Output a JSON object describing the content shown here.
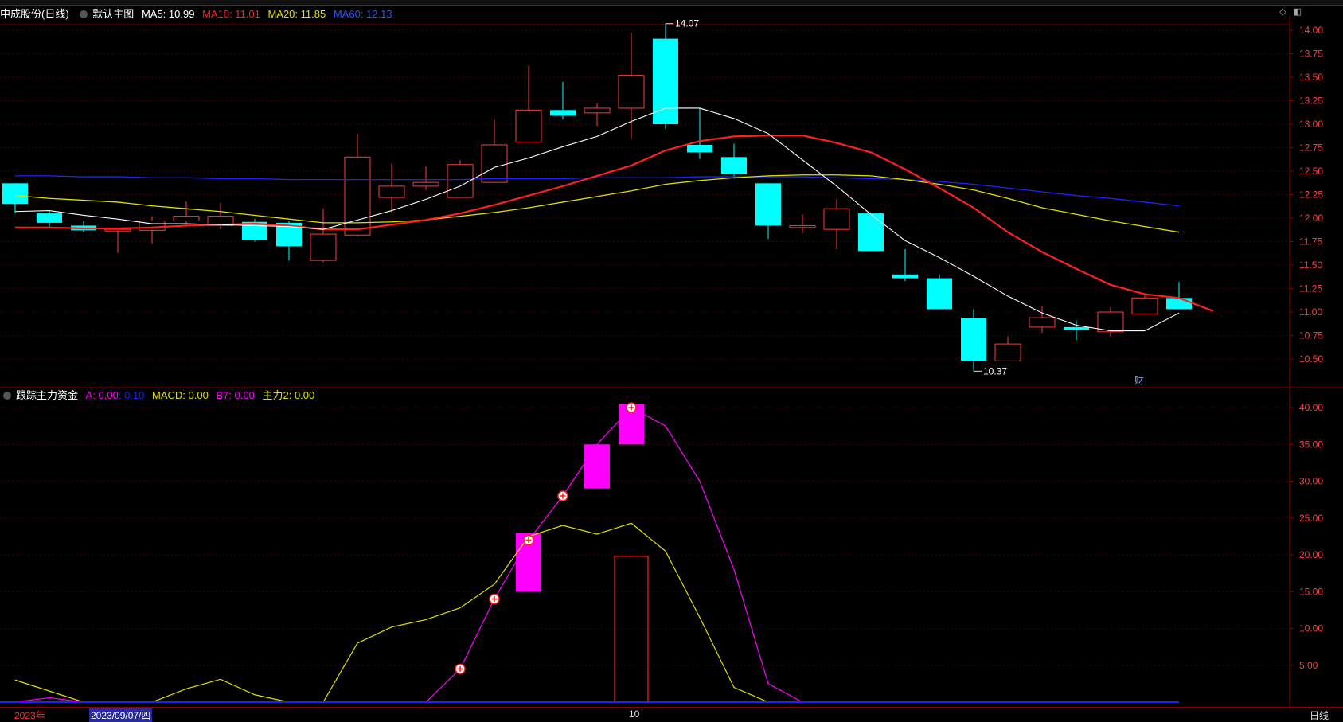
{
  "header": {
    "stock_title": "中成股份(日线)",
    "template_label": "默认主图",
    "ma5": "MA5: 10.99",
    "ma10": "MA10: 11.01",
    "ma20": "MA20: 11.85",
    "ma60": "MA60: 12.13"
  },
  "sub_header": {
    "indicator_name": "跟踪主力资金",
    "a_label": "A: 0.00",
    "a_extra": ": 0.10",
    "macd_label": "MACD: 0.00",
    "b7_label": "B7: 0.00",
    "zhuli2_label": "主力2: 0.00"
  },
  "annotations": {
    "high": "14.07",
    "low": "10.37",
    "cai": "财"
  },
  "bottom": {
    "year_label": "2023年",
    "cursor_date": "2023/09/07/四",
    "month_marker": "10",
    "period_tab": "日线"
  },
  "colors": {
    "up": "#ff3b3b",
    "down": "#00ffff",
    "ma5": "#ffffff",
    "ma10": "#ff2020",
    "ma20": "#e0e000",
    "ma60": "#2020ff",
    "magenta": "#ff00ff",
    "grid": "#8b0000"
  },
  "chart_data": [
    {
      "type": "candlestick",
      "name": "main",
      "ylim": [
        10.37,
        14.07
      ],
      "y_ticks": [
        10.5,
        10.75,
        11.0,
        11.25,
        11.5,
        11.75,
        12.0,
        12.25,
        12.5,
        12.75,
        13.0,
        13.25,
        13.5,
        13.75,
        14.0
      ],
      "candles": [
        {
          "o": 12.37,
          "c": 12.15,
          "h": 12.37,
          "l": 12.05
        },
        {
          "o": 12.05,
          "c": 11.95,
          "h": 12.08,
          "l": 11.9
        },
        {
          "o": 11.92,
          "c": 11.87,
          "h": 11.97,
          "l": 11.85
        },
        {
          "o": 11.87,
          "c": 11.88,
          "h": 11.9,
          "l": 11.63
        },
        {
          "o": 11.87,
          "c": 11.97,
          "h": 12.02,
          "l": 11.73
        },
        {
          "o": 11.97,
          "c": 12.02,
          "h": 12.18,
          "l": 11.92
        },
        {
          "o": 11.92,
          "c": 12.02,
          "h": 12.16,
          "l": 11.88
        },
        {
          "o": 11.96,
          "c": 11.77,
          "h": 11.99,
          "l": 11.75
        },
        {
          "o": 11.95,
          "c": 11.7,
          "h": 11.97,
          "l": 11.55
        },
        {
          "o": 11.55,
          "c": 11.83,
          "h": 12.1,
          "l": 11.53
        },
        {
          "o": 11.82,
          "c": 12.65,
          "h": 12.9,
          "l": 11.8
        },
        {
          "o": 12.22,
          "c": 12.34,
          "h": 12.58,
          "l": 12.05
        },
        {
          "o": 12.34,
          "c": 12.38,
          "h": 12.55,
          "l": 12.3
        },
        {
          "o": 12.22,
          "c": 12.57,
          "h": 12.62,
          "l": 12.22
        },
        {
          "o": 12.38,
          "c": 12.78,
          "h": 13.05,
          "l": 12.38
        },
        {
          "o": 12.81,
          "c": 13.15,
          "h": 13.62,
          "l": 12.81
        },
        {
          "o": 13.15,
          "c": 13.09,
          "h": 13.45,
          "l": 13.05
        },
        {
          "o": 13.12,
          "c": 13.17,
          "h": 13.22,
          "l": 12.98
        },
        {
          "o": 13.17,
          "c": 13.52,
          "h": 13.97,
          "l": 12.85
        },
        {
          "o": 13.91,
          "c": 13.0,
          "h": 14.07,
          "l": 12.95
        },
        {
          "o": 12.78,
          "c": 12.7,
          "h": 13.17,
          "l": 12.63
        },
        {
          "o": 12.65,
          "c": 12.47,
          "h": 12.79,
          "l": 12.42
        },
        {
          "o": 12.37,
          "c": 11.92,
          "h": 12.37,
          "l": 11.78
        },
        {
          "o": 11.9,
          "c": 11.92,
          "h": 12.04,
          "l": 11.84
        },
        {
          "o": 11.88,
          "c": 12.1,
          "h": 12.2,
          "l": 11.67
        },
        {
          "o": 12.05,
          "c": 11.65,
          "h": 12.05,
          "l": 11.65
        },
        {
          "o": 11.4,
          "c": 11.36,
          "h": 11.67,
          "l": 11.33
        },
        {
          "o": 11.36,
          "c": 11.03,
          "h": 11.4,
          "l": 11.03
        },
        {
          "o": 10.94,
          "c": 10.48,
          "h": 11.03,
          "l": 10.37
        },
        {
          "o": 10.48,
          "c": 10.66,
          "h": 10.74,
          "l": 10.48
        },
        {
          "o": 10.84,
          "c": 10.94,
          "h": 11.06,
          "l": 10.78
        },
        {
          "o": 10.84,
          "c": 10.81,
          "h": 10.91,
          "l": 10.7
        },
        {
          "o": 10.79,
          "c": 11.0,
          "h": 11.05,
          "l": 10.74
        },
        {
          "o": 10.98,
          "c": 11.15,
          "h": 11.18,
          "l": 10.98
        },
        {
          "o": 11.15,
          "c": 11.03,
          "h": 11.32,
          "l": 11.03
        }
      ],
      "ma5": [
        12.07,
        12.08,
        12.03,
        11.99,
        11.94,
        11.94,
        11.93,
        11.92,
        11.91,
        11.88,
        11.98,
        12.08,
        12.2,
        12.34,
        12.54,
        12.64,
        12.76,
        12.87,
        13.03,
        13.17,
        13.17,
        13.06,
        12.9,
        12.62,
        12.34,
        12.04,
        11.76,
        11.58,
        11.38,
        11.17,
        10.99,
        10.86,
        10.8,
        10.8,
        10.99
      ],
      "ma10": [
        11.9,
        11.9,
        11.89,
        11.89,
        11.9,
        11.92,
        11.93,
        11.94,
        11.92,
        11.88,
        11.88,
        11.93,
        11.98,
        12.05,
        12.14,
        12.24,
        12.34,
        12.45,
        12.56,
        12.72,
        12.82,
        12.87,
        12.88,
        12.88,
        12.8,
        12.7,
        12.52,
        12.32,
        12.11,
        11.85,
        11.64,
        11.46,
        11.29,
        11.19,
        11.15,
        11.01
      ],
      "ma20": [
        12.24,
        12.21,
        12.19,
        12.17,
        12.13,
        12.1,
        12.07,
        12.03,
        11.99,
        11.95,
        11.95,
        11.96,
        11.98,
        12.02,
        12.06,
        12.11,
        12.17,
        12.23,
        12.29,
        12.36,
        12.4,
        12.43,
        12.45,
        12.46,
        12.46,
        12.45,
        12.41,
        12.36,
        12.3,
        12.21,
        12.11,
        12.04,
        11.97,
        11.91,
        11.85
      ],
      "ma60": [
        12.45,
        12.45,
        12.44,
        12.44,
        12.43,
        12.43,
        12.42,
        12.42,
        12.41,
        12.41,
        12.41,
        12.41,
        12.41,
        12.41,
        12.42,
        12.42,
        12.42,
        12.43,
        12.43,
        12.43,
        12.44,
        12.44,
        12.44,
        12.44,
        12.43,
        12.42,
        12.41,
        12.39,
        12.36,
        12.32,
        12.28,
        12.24,
        12.21,
        12.17,
        12.13
      ]
    },
    {
      "type": "line",
      "name": "indicator",
      "ylim": [
        0,
        41
      ],
      "y_ticks": [
        5.0,
        10.0,
        15.0,
        20.0,
        25.0,
        30.0,
        35.0,
        40.0
      ],
      "series": [
        {
          "name": "A",
          "color": "#ff00ff",
          "values": [
            0,
            0.6,
            0,
            0,
            0,
            0,
            0,
            0,
            0,
            0,
            0,
            0,
            0,
            4.5,
            14,
            22,
            28,
            35,
            40,
            37.5,
            30,
            18,
            2.5,
            0,
            0,
            0,
            0,
            0,
            0,
            0,
            0,
            0,
            0,
            0,
            0
          ]
        },
        {
          "name": "B7",
          "color": "#e0e000",
          "values": [
            3,
            1.5,
            0,
            0,
            0,
            1.8,
            3.1,
            1,
            0,
            0,
            8,
            10.2,
            11.2,
            12.8,
            16,
            22.5,
            24,
            22.8,
            24.3,
            20.5,
            11.5,
            2,
            0,
            0,
            0,
            0,
            0,
            0,
            0,
            0,
            0,
            0,
            0,
            0,
            0
          ]
        },
        {
          "name": "MACD",
          "color": "#2020ff",
          "values": [
            0,
            0,
            0,
            0,
            0,
            0,
            0,
            0,
            0,
            0,
            0,
            0,
            0,
            0,
            0,
            0,
            0,
            0,
            0,
            0,
            0,
            0,
            0,
            0,
            0,
            0,
            0,
            0,
            0,
            0,
            0,
            0,
            0,
            0,
            0
          ]
        }
      ],
      "magenta_bars": [
        {
          "i": 15,
          "low": 15,
          "high": 23
        },
        {
          "i": 17,
          "low": 29,
          "high": 35
        },
        {
          "i": 18,
          "low": 35,
          "high": 40.5
        }
      ],
      "red_bar": {
        "i": 18,
        "low": 0,
        "high": 19.8
      },
      "markers": [
        13,
        14,
        15,
        16,
        18
      ]
    }
  ]
}
